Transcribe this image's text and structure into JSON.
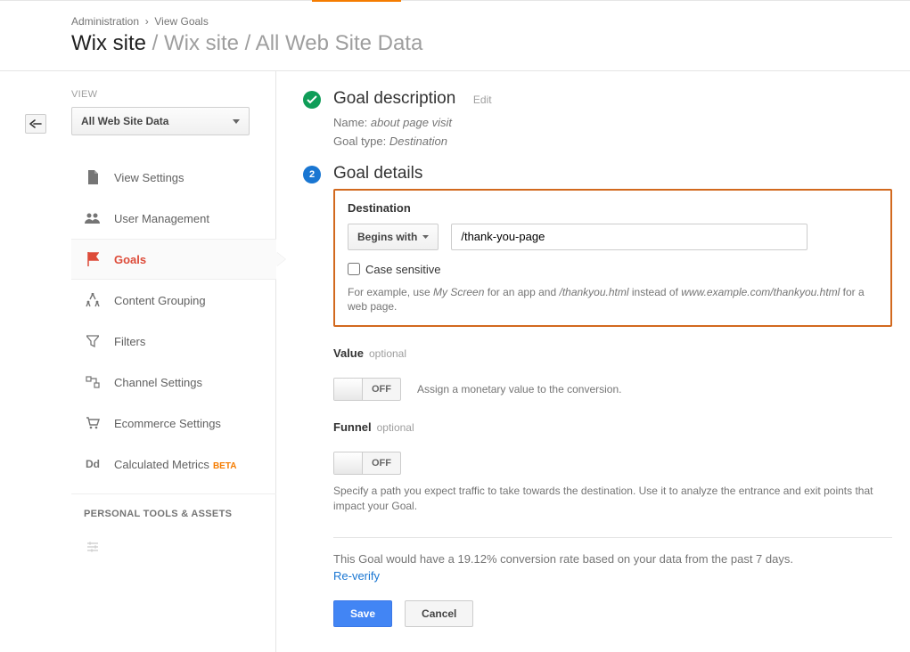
{
  "breadcrumb": {
    "admin": "Administration",
    "view_goals": "View Goals"
  },
  "title": {
    "main": "Wix site",
    "segments": " / Wix site / All Web Site Data"
  },
  "view": {
    "label": "VIEW",
    "selected": "All Web Site Data"
  },
  "nav": {
    "view_settings": "View Settings",
    "user_management": "User Management",
    "goals": "Goals",
    "content_grouping": "Content Grouping",
    "filters": "Filters",
    "channel_settings": "Channel Settings",
    "ecommerce_settings": "Ecommerce Settings",
    "calculated_metrics": "Calculated Metrics",
    "calculated_metrics_beta": "BETA",
    "section_personal": "PERSONAL TOOLS & ASSETS"
  },
  "step1": {
    "title": "Goal description",
    "edit": "Edit",
    "name_label": "Name:",
    "name_value": "about page visit",
    "type_label": "Goal type:",
    "type_value": "Destination"
  },
  "step2": {
    "num": "2",
    "title": "Goal details"
  },
  "destination": {
    "label": "Destination",
    "match_type": "Begins with",
    "value": "/thank-you-page",
    "case_sensitive": "Case sensitive",
    "hint_prefix": "For example, use ",
    "hint_app": "My Screen",
    "hint_mid1": " for an app and ",
    "hint_path": "/thankyou.html",
    "hint_mid2": " instead of ",
    "hint_url": "www.example.com/thankyou.html",
    "hint_suffix": " for a web page."
  },
  "value": {
    "label": "Value",
    "optional": "optional",
    "toggle": "OFF",
    "desc": "Assign a monetary value to the conversion."
  },
  "funnel": {
    "label": "Funnel",
    "optional": "optional",
    "toggle": "OFF",
    "desc": "Specify a path you expect traffic to take towards the destination. Use it to analyze the entrance and exit points that impact your Goal."
  },
  "conversion": {
    "text": "This Goal would have a 19.12% conversion rate based on your data from the past 7 days.",
    "reverify": "Re-verify"
  },
  "buttons": {
    "save": "Save",
    "cancel": "Cancel"
  }
}
